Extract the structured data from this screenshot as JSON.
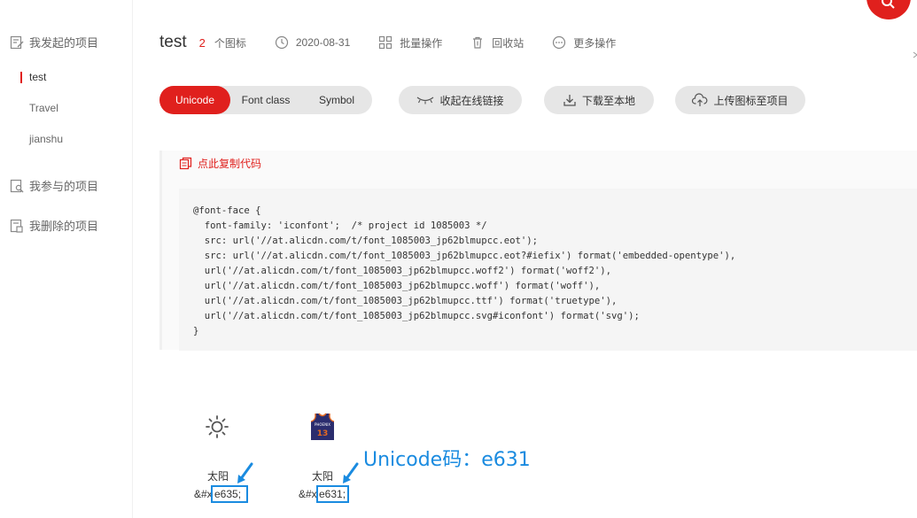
{
  "sidebar": {
    "groups": [
      {
        "label": "我发起的项目",
        "icon": "edit-document-icon"
      },
      {
        "label": "我参与的项目",
        "icon": "search-document-icon"
      },
      {
        "label": "我删除的项目",
        "icon": "deleted-document-icon"
      }
    ],
    "items": [
      {
        "label": "test",
        "active": true
      },
      {
        "label": "Travel",
        "active": false
      },
      {
        "label": "jianshu",
        "active": false
      }
    ]
  },
  "header": {
    "title": "test",
    "icon_count": "2",
    "icon_count_unit": "个图标",
    "date": "2020-08-31",
    "batch_label": "批量操作",
    "recycle_label": "回收站",
    "more_label": "更多操作"
  },
  "tabs": {
    "unicode": "Unicode",
    "font_class": "Font class",
    "symbol": "Symbol",
    "active": "Unicode"
  },
  "toolbar": {
    "collapse_link": "收起在线链接",
    "download": "下载至本地",
    "upload": "上传图标至项目"
  },
  "code_panel": {
    "copy_label": "点此复制代码",
    "code": "@font-face {\n  font-family: 'iconfont';  /* project id 1085003 */\n  src: url('//at.alicdn.com/t/font_1085003_jp62blmupcc.eot');\n  src: url('//at.alicdn.com/t/font_1085003_jp62blmupcc.eot?#iefix') format('embedded-opentype'),\n  url('//at.alicdn.com/t/font_1085003_jp62blmupcc.woff2') format('woff2'),\n  url('//at.alicdn.com/t/font_1085003_jp62blmupcc.woff') format('woff'),\n  url('//at.alicdn.com/t/font_1085003_jp62blmupcc.ttf') format('truetype'),\n  url('//at.alicdn.com/t/font_1085003_jp62blmupcc.svg#iconfont') format('svg');\n}"
  },
  "icons": [
    {
      "name": "太阳",
      "prefix": "&#x",
      "code": "e635;",
      "glyph": "sun-icon"
    },
    {
      "name": "太阳",
      "prefix": "&#x",
      "code": "e631;",
      "glyph": "jersey-icon",
      "jersey_text": "PHOENIX",
      "jersey_number": "13"
    }
  ],
  "annotation": {
    "text": "Unicode码：e631"
  },
  "colors": {
    "accent": "#e0201d",
    "highlight": "#1a8be0"
  }
}
